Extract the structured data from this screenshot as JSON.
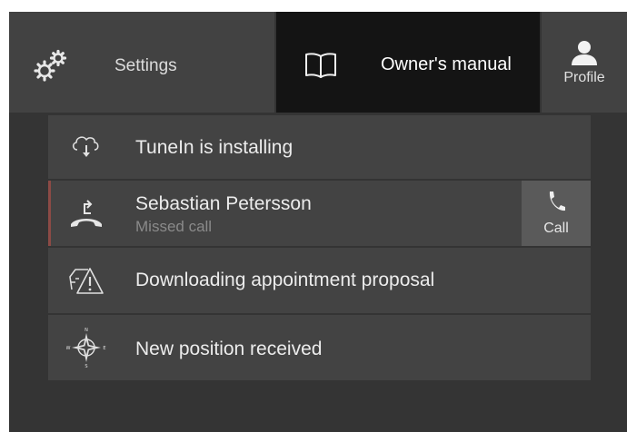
{
  "topbar": {
    "settings": {
      "label": "Settings",
      "icon": "gears-icon"
    },
    "owners_manual": {
      "label": "Owner's manual",
      "icon": "book-icon"
    },
    "profile": {
      "label": "Profile",
      "icon": "person-icon"
    }
  },
  "notifications": [
    {
      "title": "TuneIn is installing",
      "icon": "cloud-download-icon"
    },
    {
      "title": "Sebastian Petersson",
      "subtitle": "Missed call",
      "icon": "missed-call-icon",
      "action": {
        "label": "Call",
        "icon": "phone-icon"
      }
    },
    {
      "title": "Downloading appointment proposal",
      "icon": "car-warning-icon"
    },
    {
      "title": "New position received",
      "icon": "compass-icon"
    }
  ],
  "colors": {
    "background": "#343434",
    "tile": "#424242",
    "active_tile": "#141414",
    "row": "#434343",
    "missed_call_accent": "#8c4a45"
  }
}
